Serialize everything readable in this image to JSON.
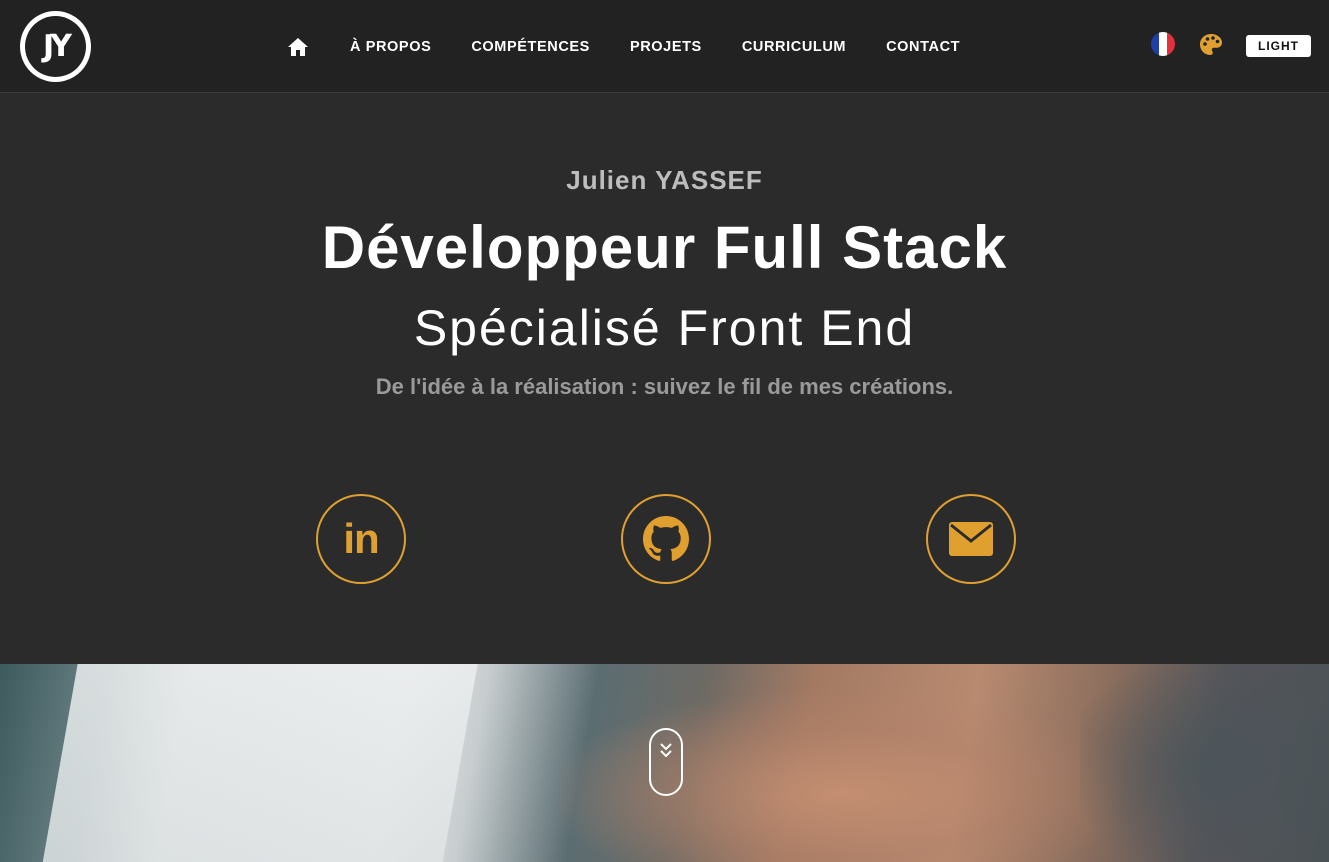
{
  "nav": {
    "logo_text": "JY",
    "home_icon": "home-icon",
    "links": [
      "À PROPOS",
      "COMPÉTENCES",
      "PROJETS",
      "CURRICULUM",
      "CONTACT"
    ],
    "language": "FR",
    "palette_icon": "palette-icon",
    "theme_toggle": "LIGHT"
  },
  "hero": {
    "name": "Julien YASSEF",
    "title": "Développeur Full Stack",
    "subtitle": "Spécialisé Front End",
    "tagline": "De l'idée à la réalisation : suivez le fil de mes créations."
  },
  "social": {
    "linkedin": "in",
    "icons": [
      "linkedin-icon",
      "github-icon",
      "mail-icon"
    ]
  },
  "colors": {
    "accent": "#e0a030",
    "background": "#2b2b2b",
    "navbar": "#222222"
  }
}
